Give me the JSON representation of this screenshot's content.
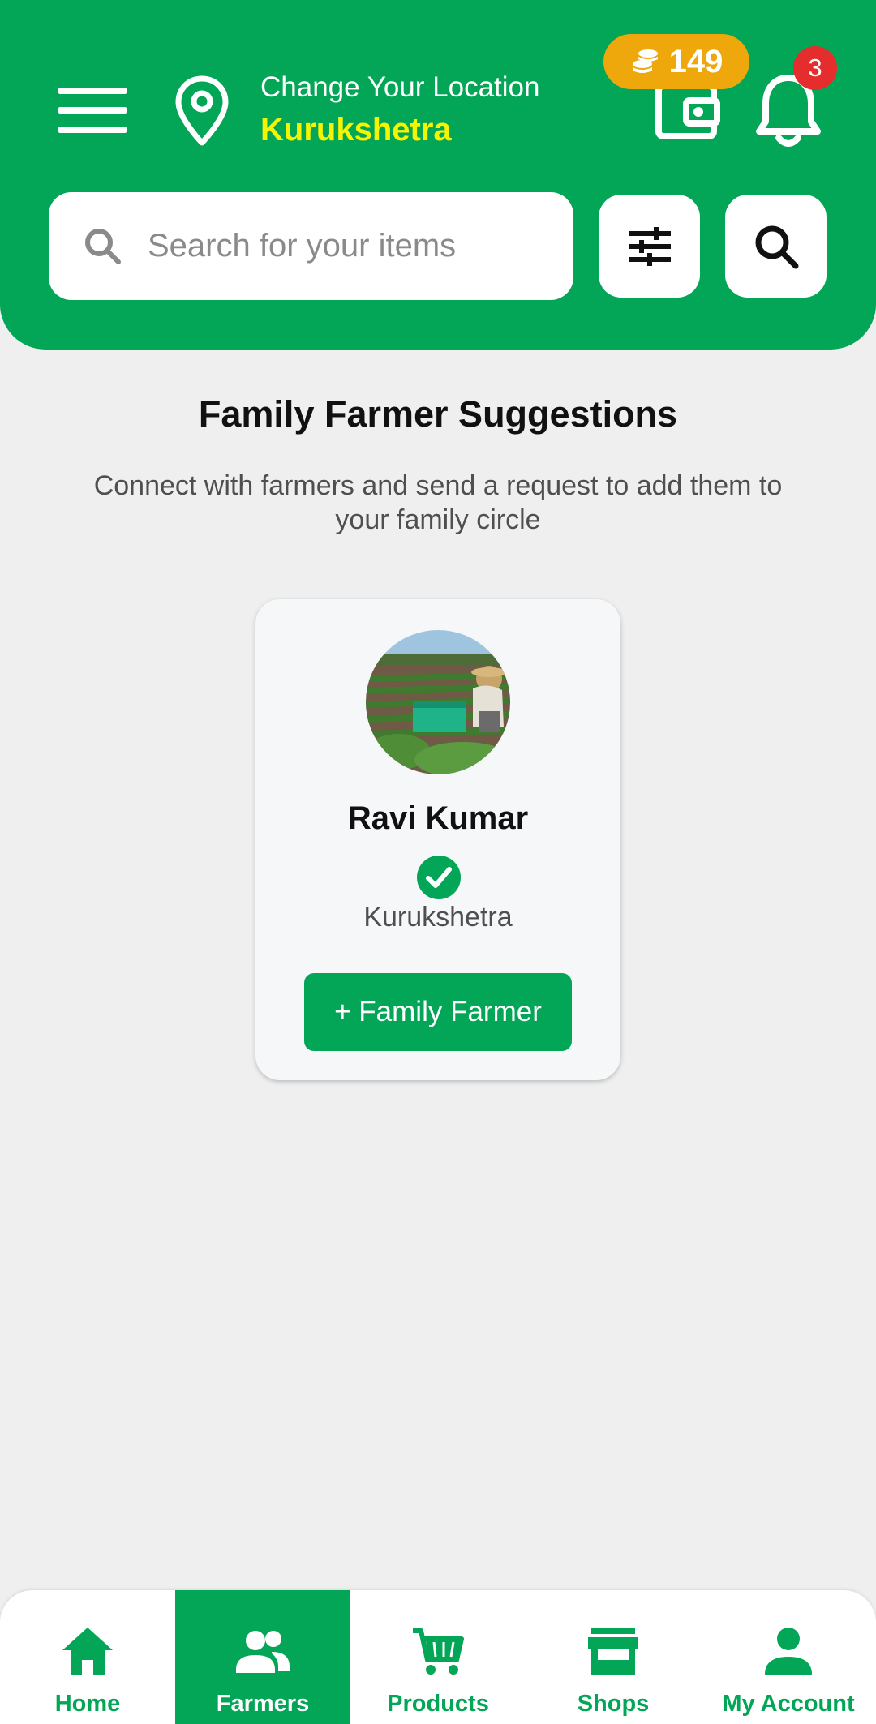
{
  "colors": {
    "brand_green": "#03a556",
    "city_yellow": "#f6f500",
    "coins_orange": "#eea80b",
    "notification_red": "#e52d2d"
  },
  "header": {
    "menu_icon": "hamburger-menu-icon",
    "location_icon": "map-pin-icon",
    "location_label": "Change Your Location",
    "location_city": "Kurukshetra",
    "wallet_icon": "wallet-icon",
    "coins_icon": "coins-icon",
    "coins_count": "149",
    "bell_icon": "bell-icon",
    "notification_count": "3"
  },
  "search": {
    "placeholder": "Search for your items",
    "value": "",
    "filter_icon": "sliders-icon",
    "search_button_icon": "search-icon"
  },
  "main": {
    "title": "Family Farmer Suggestions",
    "subtitle": "Connect with farmers and send a request to add them to your family circle",
    "farmers": [
      {
        "name": "Ravi Kumar",
        "verified": true,
        "location": "Kurukshetra",
        "button_label": "+ Family Farmer"
      }
    ]
  },
  "bottom_nav": {
    "items": [
      {
        "label": "Home",
        "icon": "home-icon",
        "active": false
      },
      {
        "label": "Farmers",
        "icon": "people-icon",
        "active": true
      },
      {
        "label": "Products",
        "icon": "cart-icon",
        "active": false
      },
      {
        "label": "Shops",
        "icon": "shop-icon",
        "active": false
      },
      {
        "label": "My Account",
        "icon": "person-icon",
        "active": false
      }
    ]
  }
}
